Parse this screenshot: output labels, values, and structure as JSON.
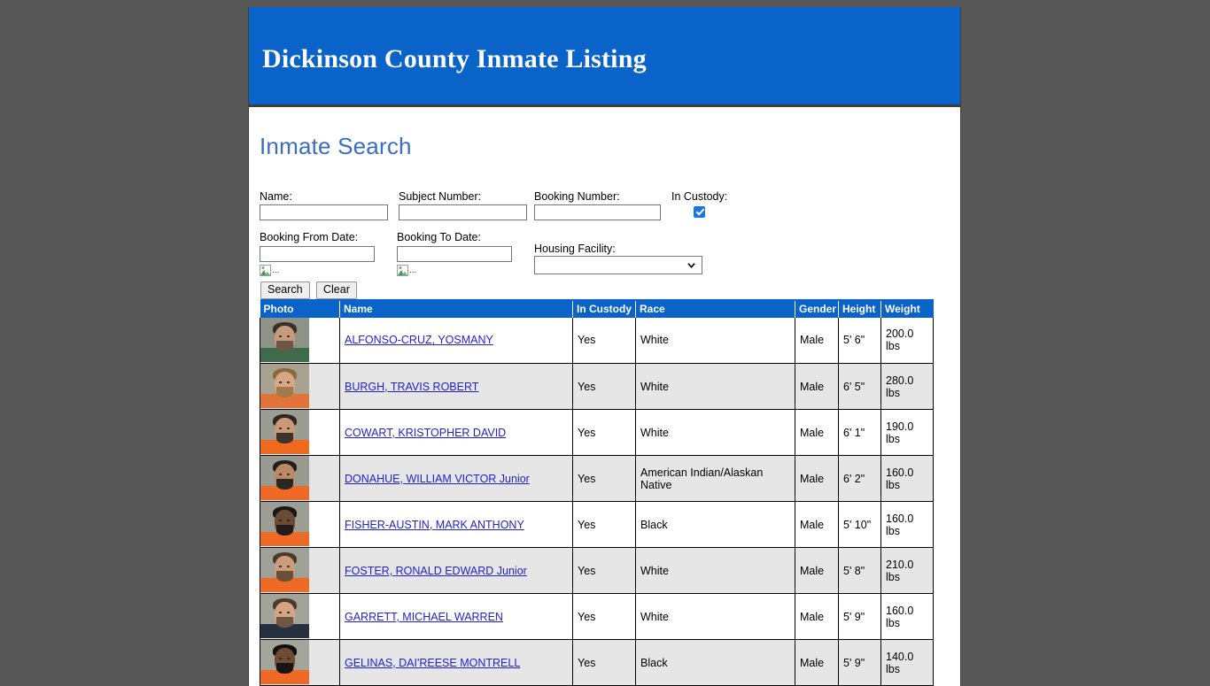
{
  "banner": {
    "title": "Dickinson County Inmate Listing",
    "background_color": "#0a63c9"
  },
  "page": {
    "heading": "Inmate Search",
    "background_color": "#575757",
    "heading_color": "#3a6ec0"
  },
  "search_form": {
    "name_label": "Name:",
    "name_value": "",
    "subject_number_label": "Subject Number:",
    "subject_number_value": "",
    "booking_number_label": "Booking Number:",
    "booking_number_value": "",
    "in_custody_label": "In Custody:",
    "in_custody_checked": true,
    "booking_from_label": "Booking From Date:",
    "booking_from_value": "",
    "booking_to_label": "Booking To Date:",
    "booking_to_value": "",
    "housing_facility_label": "Housing Facility:",
    "housing_facility_value": "",
    "housing_facility_options": [
      ""
    ],
    "from_date_picker_alt": "...",
    "to_date_picker_alt": "...",
    "search_button": "Search",
    "clear_button": "Clear"
  },
  "results_table": {
    "columns": [
      "Photo",
      "Name",
      "In Custody",
      "Race",
      "Gender",
      "Height",
      "Weight"
    ],
    "rows": [
      {
        "name": "ALFONSO-CRUZ, YOSMANY",
        "in_custody": "Yes",
        "race": "White",
        "gender": "Male",
        "height": "5' 6\"",
        "weight": "200.0 lbs",
        "photo": {
          "bg": "#8e9287",
          "shirt": "#3f6b4a",
          "skin": "#c79a7d",
          "hair": "#3a2f27",
          "beard": "#6b5648"
        }
      },
      {
        "name": "BURGH, TRAVIS ROBERT",
        "in_custody": "Yes",
        "race": "White",
        "gender": "Male",
        "height": "6' 5\"",
        "weight": "280.0 lbs",
        "photo": {
          "bg": "#a8a291",
          "shirt": "#e2743a",
          "skin": "#d7a684",
          "hair": "#8a6a41",
          "beard": "#a07a4c"
        }
      },
      {
        "name": "COWART, KRISTOPHER DAVID",
        "in_custody": "Yes",
        "race": "White",
        "gender": "Male",
        "height": "6' 1\"",
        "weight": "190.0 lbs",
        "photo": {
          "bg": "#9b9d92",
          "shirt": "#f06a1e",
          "skin": "#c99a78",
          "hair": "#2f2721",
          "beard": "#3c332b"
        }
      },
      {
        "name": "DONAHUE, WILLIAM VICTOR Junior",
        "in_custody": "Yes",
        "race": "American Indian/Alaskan Native",
        "gender": "Male",
        "height": "6' 2\"",
        "weight": "160.0 lbs",
        "photo": {
          "bg": "#9a9b90",
          "shirt": "#ef6a24",
          "skin": "#bb8a64",
          "hair": "#22201d",
          "beard": "#2a2622"
        }
      },
      {
        "name": "FISHER-AUSTIN, MARK ANTHONY",
        "in_custody": "Yes",
        "race": "Black",
        "gender": "Male",
        "height": "5' 10\"",
        "weight": "160.0 lbs",
        "photo": {
          "bg": "#9d9e93",
          "shirt": "#ef6a24",
          "skin": "#6b4a36",
          "hair": "#1b1715",
          "beard": "#211c18"
        }
      },
      {
        "name": "FOSTER, RONALD EDWARD Junior",
        "in_custody": "Yes",
        "race": "White",
        "gender": "Male",
        "height": "5' 8\"",
        "weight": "210.0 lbs",
        "photo": {
          "bg": "#9fa096",
          "shirt": "#ef6a24",
          "skin": "#cc9d7c",
          "hair": "#4a3a2c",
          "beard": "#6a4f37"
        }
      },
      {
        "name": "GARRETT, MICHAEL WARREN",
        "in_custody": "Yes",
        "race": "White",
        "gender": "Male",
        "height": "5' 9\"",
        "weight": "160.0 lbs",
        "photo": {
          "bg": "#a2a49a",
          "shirt": "#26303f",
          "skin": "#d4a585",
          "hair": "#4a3b2e",
          "beard": "#6d5742"
        }
      },
      {
        "name": "GELINAS, DAI'REESE MONTRELL",
        "in_custody": "Yes",
        "race": "Black",
        "gender": "Male",
        "height": "5' 9\"",
        "weight": "140.0 lbs",
        "photo": {
          "bg": "#a3a59a",
          "shirt": "#ef6a24",
          "skin": "#6f4c35",
          "hair": "#120f0e",
          "beard": "#1a1513"
        }
      }
    ]
  }
}
